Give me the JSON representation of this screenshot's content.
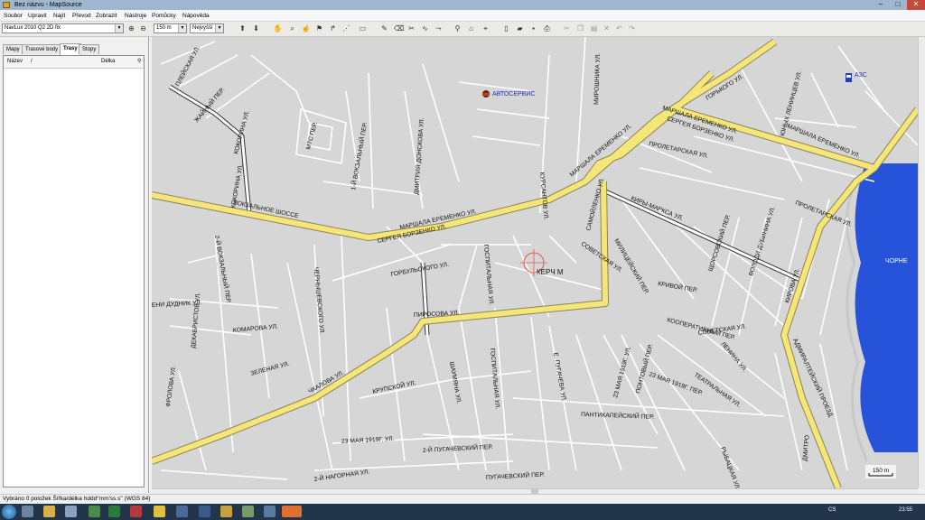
{
  "window": {
    "title": "Bez názvu - MapSource"
  },
  "menu": [
    "Soubor",
    "Upravit",
    "Najít",
    "Převod",
    "Zobrazit",
    "Nástroje",
    "Pomůcky",
    "Nápověda"
  ],
  "toolbar": {
    "map_product": "NavLux 2010 Q2 2D fix",
    "zoom": "150 m",
    "detail": "Nejvyšší"
  },
  "left_panel": {
    "tabs": [
      "Mapy",
      "Trasové body",
      "Trasy",
      "Stopy"
    ],
    "active_tab": "Trasy",
    "columns": {
      "name": "Název",
      "sort": "/",
      "length": "Délka"
    }
  },
  "map": {
    "scale_label": "150 m",
    "poi": [
      {
        "name": "АВТОСЕРВИС",
        "icon": "car-service-icon"
      },
      {
        "name": "АЗС",
        "icon": "fuel-station-icon"
      }
    ],
    "city_label": "КЕРЧ М",
    "edge_label": "ЧОРНЕ",
    "streets": {
      "s1": "ПЛЕЙСКАЯ УЛ.",
      "s2": "ЖАЙНЫЙ ПЕР.",
      "s3": "КОКОРИНА УЛ.",
      "s4": "КОКОРИНА УЛ.",
      "s5": "МТС ПЕР.",
      "s6": "1-Й ВОКЗАЛЬНЫЙ ПЕР.",
      "s7": "ДМИТРИЯ ДОНСКОВА УЛ.",
      "s8": "МИРОШНИКА УЛ.",
      "s9": "ГОРЬКОГО УЛ.",
      "s10": "МАРШАЛА ЕРЕМЕНКО УЛ.",
      "s11": "СЕРГЕЯ БОРЗЕНКО УЛ.",
      "s12": "МАРШАЛА ЕРЕМЕНКО УЛ.",
      "s13": "ЮНЫХ ЛЕНИНЦЕВ УЛ.",
      "s14": "МАРШАЛА ЕРЕМЕНКО УЛ.",
      "s15": "ПРОЛЕТАРСКАЯ УЛ.",
      "s16": "ВОКЗАЛЬНОЕ ШОССЕ",
      "s17": "МАРШАЛА ЕРЕМЕНКО УЛ.",
      "s18": "СЕРГЕЯ БОРЗЕНКО УЛ.",
      "s19": "КУРСАНТОВ УЛ.",
      "s20": "САМОЙЛЕНКО УЛ.",
      "s21": "КИРЫ-МАРКСА УЛ.",
      "s22": "ВОЛОДИ ДУБИНИНА УЛ.",
      "s23": "ПРОЛЕТАРСКАЯ УЛ.",
      "s24": "2-Й ВОКЗАЛЬНЫЙ ПЕР.",
      "s25": "ГОРБУЛЬСКОГО УЛ.",
      "s26": "ГОСПИТАЛЬНАЯ УЛ.",
      "s27": "СОВЕТСКАЯ УЛ.",
      "s28": "МИЛИЦЕЙСКИЙ ПЕР.",
      "s29": "ЩОРСОВСКИЙ ПЕР.",
      "s30": "КРИВОЙ ПЕР.",
      "s31": "КИРОВА УЛ.",
      "s32": "ЕНИ ДУДНИК УЛ.",
      "s33": "ЧЕРНЫШЕВСКОГО УЛ.",
      "s34": "ПИРОСОВА УЛ.",
      "s35": "КОМАРОВА УЛ.",
      "s36": "ДЕКАБРИСТОВ УЛ.",
      "s37": "СОВЕТСКАЯ УЛ.",
      "s38": "КООПЕРАТИВНЫЙ ПЕР.",
      "s39": "ФРОЛОВА УЛ.",
      "s40": "ЗЕЛЕНАЯ УЛ.",
      "s41": "ЧКАЛОВА УЛ.",
      "s42": "КРУПСКОЙ УЛ.",
      "s43": "ШАУМЯНА УЛ.",
      "s44": "ГОСПИТАЛЬНАЯ УЛ.",
      "s45": "Е. ПУГАЧЕВА УЛ.",
      "s46": "ЛЕНИНА УЛ.",
      "s47": "ТЕАТРАЛЬНАЯ УЛ.",
      "s48": "АДМИРАЛТЕЙСКИЙ ПРОЕЗД",
      "s49": "23 МАЯ 1919Г. УЛ.",
      "s50": "ПОНТОВЫЙ ПЕР.",
      "s51": "23 МАЯ 1919Г. ПЕР.",
      "s52": "ПАНТИКАПЕЙСКИЙ ПЕР.",
      "s53": "23 МАЯ 1919Г. УЛ.",
      "s54": "2-Й ПУГАЧЕВСКИЙ ПЕР.",
      "s55": "2-Й НАГОРНАЯ УЛ.",
      "s56": "ПУГАЧЕВСКИЙ ПЕР.",
      "s57": "РЫБАЦКАЯ УЛ.",
      "s58": "ДМИТРО"
    }
  },
  "status": {
    "text": "Vybráno 0 položek  Šířka/délka hddd°mm'ss.s\" (WGS 84)"
  },
  "taskbar": {
    "lang": "CS",
    "clock": "23:55"
  }
}
